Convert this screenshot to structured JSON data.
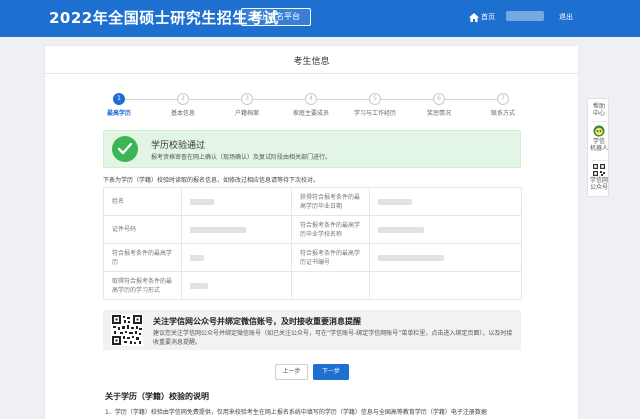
{
  "header": {
    "title": "2022年全国硕士研究生招生考试",
    "platform": "网上报名平台",
    "home": "首页",
    "logout": "退出"
  },
  "page": {
    "title": "考生信息"
  },
  "steps": [
    {
      "num": "1",
      "label": "最高学历"
    },
    {
      "num": "2",
      "label": "基本信息"
    },
    {
      "num": "3",
      "label": "户籍档案"
    },
    {
      "num": "4",
      "label": "家庭主要成员"
    },
    {
      "num": "5",
      "label": "学习与工作经历"
    },
    {
      "num": "6",
      "label": "奖惩情况"
    },
    {
      "num": "7",
      "label": "联系方式"
    }
  ],
  "success": {
    "title": "学历校验通过",
    "desc": "报考资格审查在网上确认（现场确认）及复试阶段由相关部门进行。"
  },
  "hint": "下表为学历（学籍）校验时读取的报名信息，如修改过相应信息请等待下次校对。",
  "info_table": {
    "name_label": "姓名",
    "grad_date_label": "获得符合报考条件的最高学历毕业日期",
    "id_label": "证件号码",
    "school_label": "符合报考条件的最高学历毕业学校名称",
    "highest_edu_label": "符合报考条件的最高学历",
    "cert_no_label": "符合报考条件的最高学历证书编号",
    "study_form_label": "取得符合报考条件的最高学历的学习形式"
  },
  "wechat": {
    "title": "关注学信网公众号并绑定微信账号，及时接收重要消息提醒",
    "desc": "建议您关注学信网公众号并绑定微信账号（如已关注公众号，可在“学信账号-绑定学信网账号”菜单栏里，点击进入绑定页面），以及时接收重要消息提醒。"
  },
  "buttons": {
    "prev": "上一步",
    "next": "下一步"
  },
  "notes": {
    "title": "关于学历（学籍）校验的说明",
    "line1": "1、学历（学籍）校验由学信网免费提供，仅用来校验考生在网上报名系统中填写的学历（学籍）信息与全国高等教育学历（学籍）电子注册数据"
  },
  "side_tools": {
    "help": [
      "帮助",
      "中心"
    ],
    "robot": [
      "学信",
      "机器人"
    ],
    "official": [
      "学信网",
      "公众号"
    ]
  },
  "colors": {
    "primary": "#1d6fd0",
    "success": "#3bb556",
    "success_bg": "#e3f6e6"
  }
}
